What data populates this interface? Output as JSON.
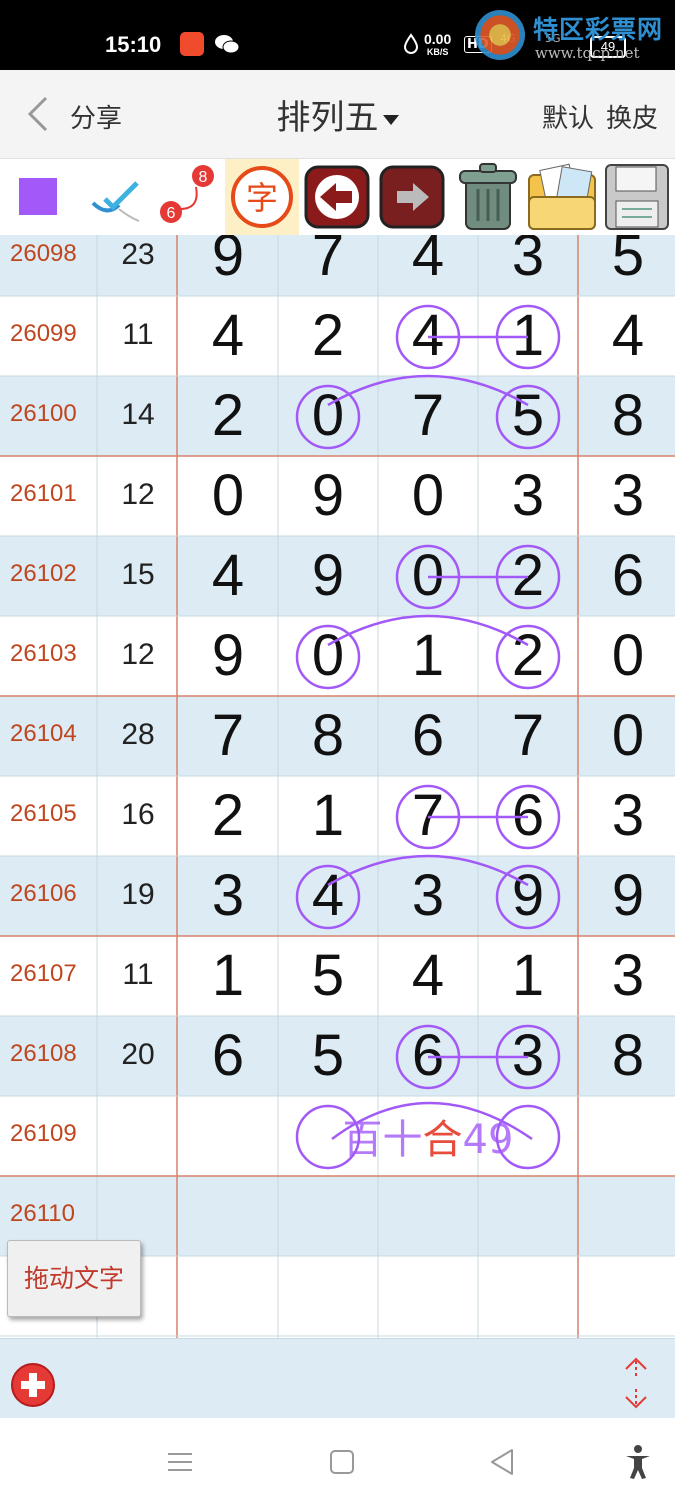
{
  "status_bar": {
    "time": "15:10",
    "net_speed": "0.00",
    "net_unit": "KB/S",
    "hd": "HD",
    "signal_1": "4G",
    "signal_2": "5G",
    "battery": "49"
  },
  "watermark": {
    "title": "特区彩票网",
    "url": "www.tqcp.net"
  },
  "header": {
    "share": "分享",
    "title": "排列五",
    "default": "默认",
    "skin": "换皮"
  },
  "toolbar": {
    "items": [
      {
        "icon": "color-square-icon",
        "color": "#a259f7"
      },
      {
        "icon": "check-pen-icon"
      },
      {
        "icon": "number-link-icon",
        "label_a": "8",
        "label_b": "6"
      },
      {
        "icon": "text-char-icon",
        "label": "字"
      },
      {
        "icon": "undo-arrow-icon"
      },
      {
        "icon": "redo-arrow-icon"
      },
      {
        "icon": "trash-can-icon"
      },
      {
        "icon": "photo-folder-icon"
      },
      {
        "icon": "save-disk-icon"
      }
    ]
  },
  "colors": {
    "accent": "#a259f7",
    "issue_text": "#c0461e",
    "row_blue": "#dcebf4",
    "separator_red": "#d9826b"
  },
  "rows": [
    {
      "issue": "26098",
      "sum": "23",
      "digits": [
        "9",
        "7",
        "4",
        "3",
        "5"
      ]
    },
    {
      "issue": "26099",
      "sum": "11",
      "digits": [
        "4",
        "2",
        "4",
        "1",
        "4"
      ]
    },
    {
      "issue": "26100",
      "sum": "14",
      "digits": [
        "2",
        "0",
        "7",
        "5",
        "8"
      ]
    },
    {
      "issue": "26101",
      "sum": "12",
      "digits": [
        "0",
        "9",
        "0",
        "3",
        "3"
      ]
    },
    {
      "issue": "26102",
      "sum": "15",
      "digits": [
        "4",
        "9",
        "0",
        "2",
        "6"
      ]
    },
    {
      "issue": "26103",
      "sum": "12",
      "digits": [
        "9",
        "0",
        "1",
        "2",
        "0"
      ]
    },
    {
      "issue": "26104",
      "sum": "28",
      "digits": [
        "7",
        "8",
        "6",
        "7",
        "0"
      ]
    },
    {
      "issue": "26105",
      "sum": "16",
      "digits": [
        "2",
        "1",
        "7",
        "6",
        "3"
      ]
    },
    {
      "issue": "26106",
      "sum": "19",
      "digits": [
        "3",
        "4",
        "3",
        "9",
        "9"
      ]
    },
    {
      "issue": "26107",
      "sum": "11",
      "digits": [
        "1",
        "5",
        "4",
        "1",
        "3"
      ]
    },
    {
      "issue": "26108",
      "sum": "20",
      "digits": [
        "6",
        "5",
        "6",
        "3",
        "8"
      ]
    },
    {
      "issue": "26109",
      "sum": "",
      "digits": [
        "",
        "",
        "",
        "",
        ""
      ]
    },
    {
      "issue": "26110",
      "sum": "",
      "digits": [
        "",
        "",
        "",
        "",
        ""
      ]
    },
    {
      "issue": "",
      "sum": "",
      "digits": [
        "",
        "",
        "",
        "",
        ""
      ]
    }
  ],
  "annotation_text": {
    "part1": "百十",
    "part2": "合",
    "part3": "49"
  },
  "drag_button": "拖动文字",
  "bottom_bar": {
    "add_icon": "add-circle-icon",
    "resize_icon": "expand-vertical-icon"
  },
  "nav": {
    "items": [
      "menu-icon",
      "home-square-icon",
      "back-triangle-icon",
      "accessibility-icon"
    ]
  }
}
